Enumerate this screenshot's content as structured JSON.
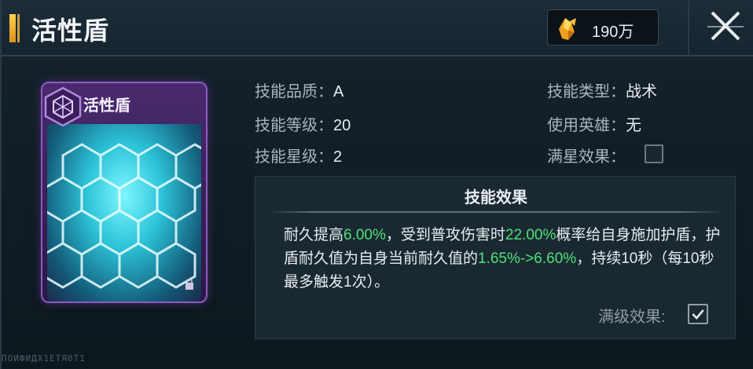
{
  "header": {
    "title": "活性盾",
    "currency_value": "190万",
    "currency_icon": "gold-crystal-icon",
    "close_icon": "close-icon"
  },
  "card": {
    "name": "活性盾",
    "emblem_icon": "hexagon-emblem-icon",
    "rarity_color": "#8a5cc0"
  },
  "info_left": [
    {
      "label": "技能品质：",
      "value": "A"
    },
    {
      "label": "技能等级：",
      "value": "20"
    },
    {
      "label": "技能星级：",
      "value": "2"
    }
  ],
  "info_right": [
    {
      "label": "技能类型：",
      "value": "战术"
    },
    {
      "label": "使用英雄：",
      "value": "无"
    },
    {
      "label": "满星效果：",
      "value": ""
    }
  ],
  "effect": {
    "title": "技能效果",
    "t1": "耐久提高",
    "h1": "6.00%",
    "t2": "，受到普攻伤害时",
    "h2": "22.00%",
    "t3": "概率给自身施加护盾，护盾耐久值为自身当前耐久值的",
    "h3": "1.65%->6.60%",
    "t4": "，持续10秒（每10秒最多触发1次）。",
    "max_level_label": "满级效果:",
    "max_level_checked": true
  },
  "footer_code": "ПОИФИДХ1ЕТЯ0Т1",
  "colors": {
    "highlight": "#4fe07a",
    "accent": "#ffd24a"
  }
}
